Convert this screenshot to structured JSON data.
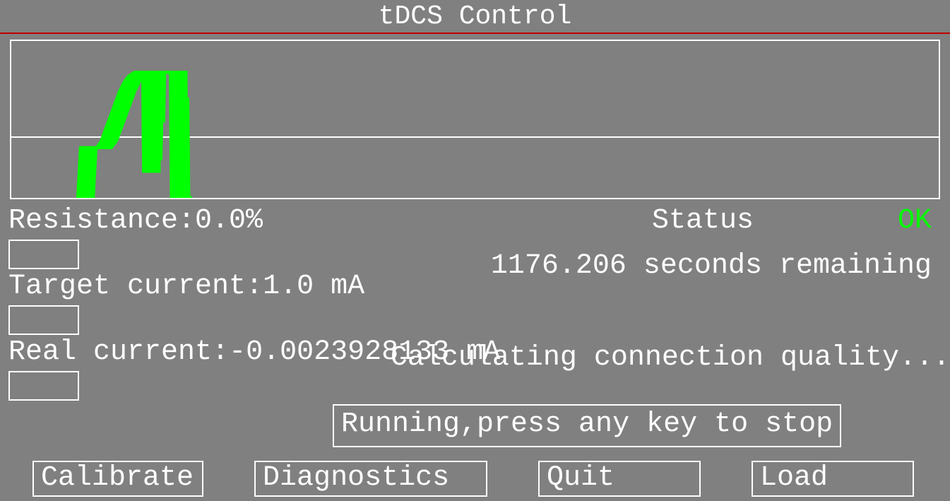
{
  "title": "tDCS Control",
  "chart_data": {
    "type": "line",
    "title": "",
    "xlabel": "",
    "ylabel": "",
    "ylim": [
      -1.0,
      1.5
    ],
    "x": [
      8,
      8.3,
      8.6,
      9,
      9.5,
      10,
      10.5,
      11,
      11.5,
      12,
      12.5,
      13,
      13.5,
      14,
      14.5,
      15,
      15.1,
      15.2,
      15.3,
      15.5,
      15.6,
      15.7,
      15.8,
      16,
      16.5,
      17,
      17.5,
      18,
      18.1,
      18.2,
      18.3,
      18.5,
      18.7,
      19,
      19.5
    ],
    "values": [
      -1.0,
      -0.2,
      -0.2,
      -0.2,
      -0.2,
      -0.2,
      -0.1,
      0.1,
      0.3,
      0.5,
      0.7,
      0.85,
      0.95,
      1.0,
      1.0,
      1.0,
      -0.6,
      1.0,
      -0.4,
      1.0,
      0.2,
      1.0,
      1.0,
      1.0,
      1.0,
      1.0,
      1.0,
      1.0,
      -1.0,
      0.6,
      -1.0,
      -1.0,
      -1.0,
      -1.0,
      -1.0
    ]
  },
  "left": {
    "resistance_label": "Resistance:",
    "resistance_value": "0.0%",
    "target_current_label": "Target current:",
    "target_current_value": "1.0 mA",
    "real_current_label": "Real current:",
    "real_current_value": "-0.0023928133 mA"
  },
  "status": {
    "label": "Status",
    "value": "OK"
  },
  "remaining": {
    "value": "1176.206",
    "unit": "seconds remaining"
  },
  "calc_msg": "Calculating connection quality...",
  "running_msg": "Running,press any key to stop",
  "buttons": {
    "calibrate": "Calibrate",
    "diagnostics": "Diagnostics",
    "quit": "Quit",
    "load": "Load"
  },
  "colors": {
    "bg": "#808080",
    "fg": "#ffffff",
    "trace": "#00ff00",
    "ok": "#00ff00",
    "rule": "#c00000"
  }
}
